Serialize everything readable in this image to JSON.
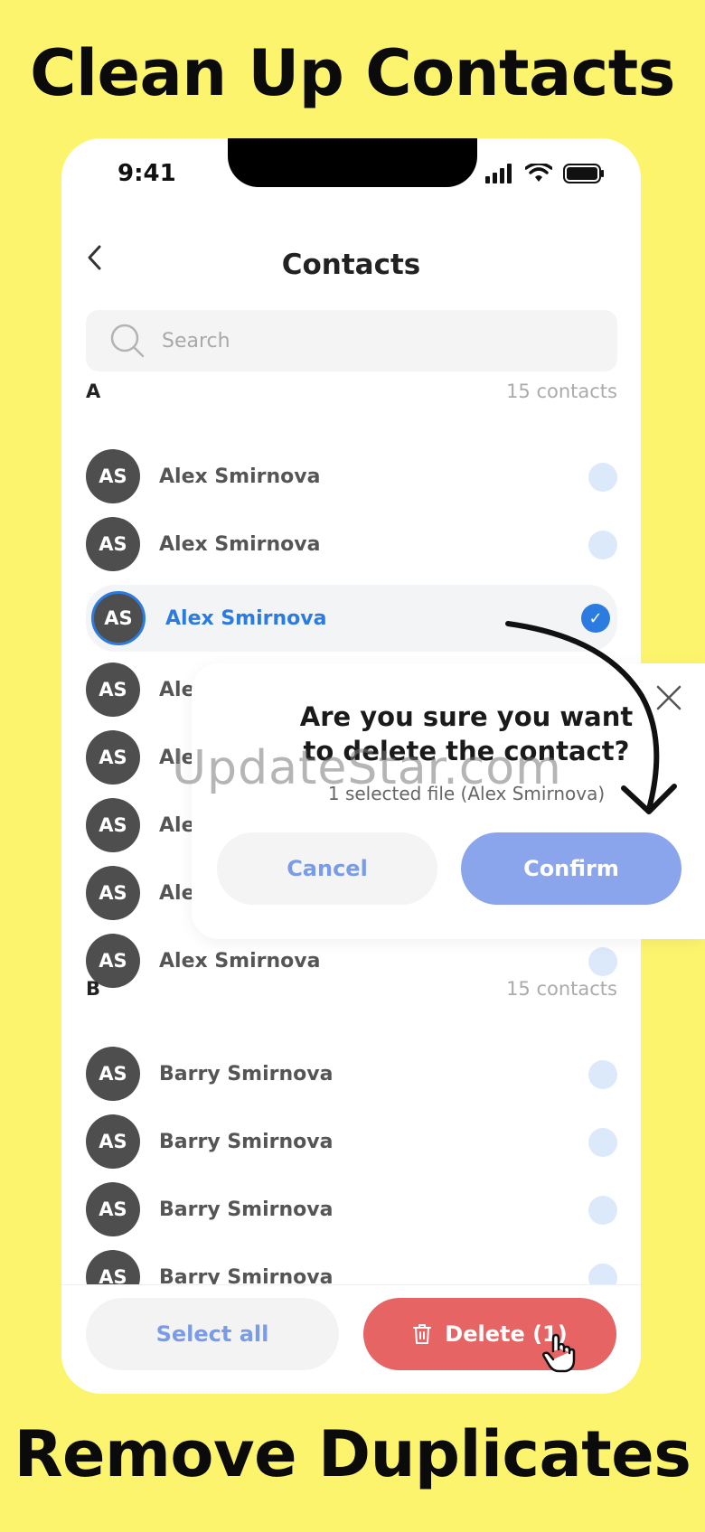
{
  "headline_top": "Clean Up Contacts",
  "headline_bottom": "Remove Duplicates",
  "status": {
    "time": "9:41"
  },
  "nav": {
    "title": "Contacts"
  },
  "search": {
    "placeholder": "Search"
  },
  "sections": [
    {
      "letter": "A",
      "count": "15 contacts",
      "contacts": [
        {
          "initials": "AS",
          "name": "Alex Smirnova",
          "selected": false
        },
        {
          "initials": "AS",
          "name": "Alex Smirnova",
          "selected": false
        },
        {
          "initials": "AS",
          "name": "Alex Smirnova",
          "selected": true
        },
        {
          "initials": "AS",
          "name": "Ale",
          "selected": false
        },
        {
          "initials": "AS",
          "name": "Ale",
          "selected": false
        },
        {
          "initials": "AS",
          "name": "Ale",
          "selected": false
        },
        {
          "initials": "AS",
          "name": "Ale",
          "selected": false
        },
        {
          "initials": "AS",
          "name": "Alex Smirnova",
          "selected": false
        }
      ]
    },
    {
      "letter": "B",
      "count": "15 contacts",
      "contacts": [
        {
          "initials": "AS",
          "name": "Barry Smirnova",
          "selected": false
        },
        {
          "initials": "AS",
          "name": "Barry Smirnova",
          "selected": false
        },
        {
          "initials": "AS",
          "name": "Barry Smirnova",
          "selected": false
        },
        {
          "initials": "AS",
          "name": "Barry Smirnova",
          "selected": false
        }
      ]
    }
  ],
  "bottom_bar": {
    "select_all": "Select all",
    "delete": "Delete (1)"
  },
  "dialog": {
    "title_line1": "Are you sure you want",
    "title_line2": "to delete the contact?",
    "subtitle": "1 selected file (Alex Smirnova)",
    "cancel": "Cancel",
    "confirm": "Confirm"
  },
  "watermark": "UpdateStar.com",
  "colors": {
    "background": "#FDF46E",
    "accent_blue": "#2C7BE0",
    "delete_red": "#E66464",
    "confirm_blue": "#8AA5EC"
  }
}
